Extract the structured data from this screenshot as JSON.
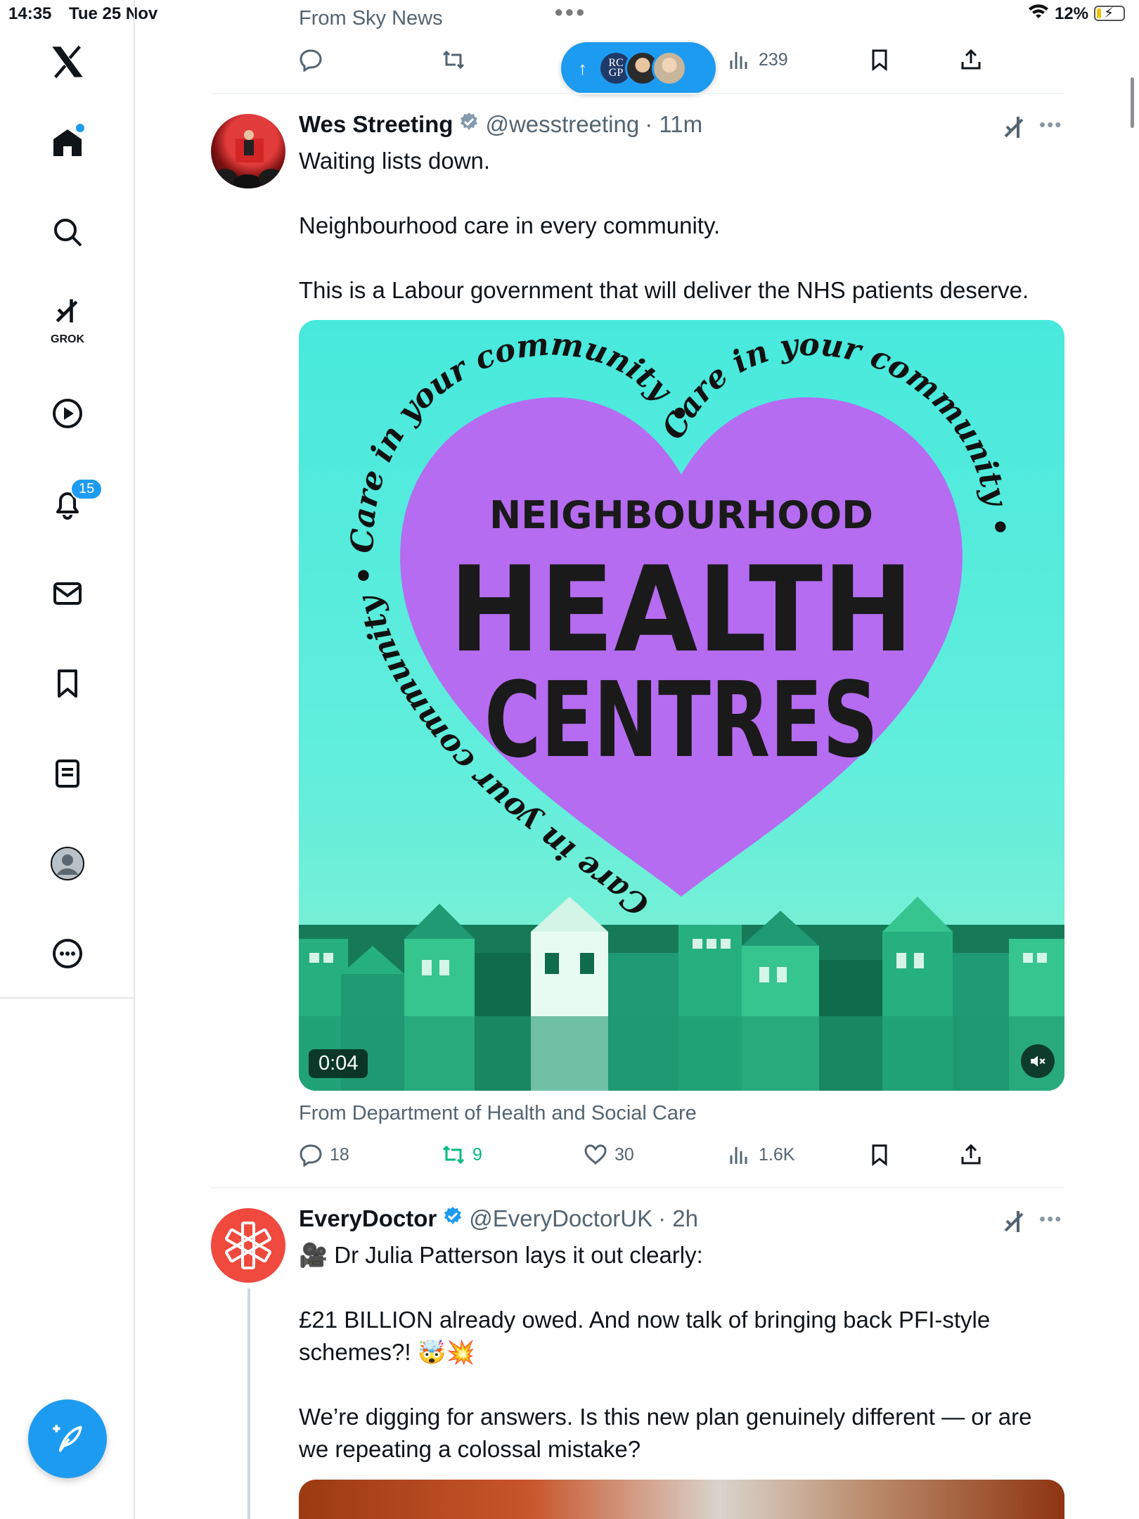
{
  "status_bar": {
    "time": "14:35",
    "date": "Tue 25 Nov",
    "battery_percent": "12%",
    "battery_level": 0.12
  },
  "sidebar": {
    "notifications_badge": "15",
    "grok_label": "GROK",
    "items": [
      "x-logo",
      "home-icon",
      "search-icon",
      "grok-icon",
      "video-icon",
      "bell-icon",
      "mail-icon",
      "bookmark-icon",
      "lists-icon",
      "profile-icon",
      "more-icon"
    ]
  },
  "previous_post": {
    "source": "From Sky News",
    "views": "239"
  },
  "new_posts_pill": {
    "avatar_1_text": "RC GP"
  },
  "tweets": [
    {
      "name": "Wes Streeting",
      "handle": "@wesstreeting",
      "time": "· 11m",
      "paragraphs": [
        "Waiting lists down.",
        "Neighbourhood care in every community.",
        "This is a Labour government that will deliver the NHS patients deserve."
      ],
      "media": {
        "headline_small": "NEIGHBOURHOOD",
        "headline_big_1": "HEALTH",
        "headline_big_2": "CENTRES",
        "ring_text": "Care in your community • Care in your community • Care in your community •",
        "duration": "0:04"
      },
      "source": "From Department of Health and Social Care",
      "replies": "18",
      "reposts": "9",
      "likes": "30",
      "views": "1.6K"
    },
    {
      "name": "EveryDoctor",
      "handle": "@EveryDoctorUK",
      "time": "· 2h",
      "paragraphs": [
        "🎥 Dr Julia Patterson lays it out clearly:",
        "£21 BILLION already owed. And now talk of bringing back PFI-style schemes?! 🤯💥",
        "We’re digging for answers. Is this new plan genuinely different — or are we repeating a colossal mistake?"
      ]
    }
  ],
  "colors": {
    "accent": "#1d9bf0",
    "repost_active": "#00ba7c",
    "heart_purple": "#b56cf0",
    "media_teal": "#48e9dd",
    "building_green": "#1f9a72"
  }
}
